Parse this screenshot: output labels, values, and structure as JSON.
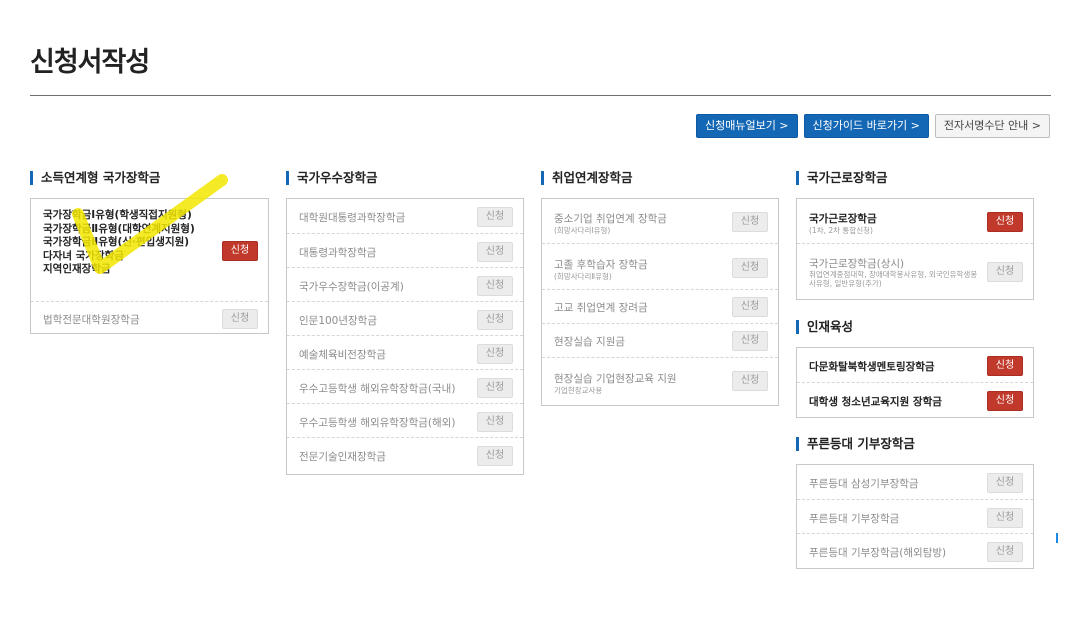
{
  "page": {
    "title": "신청서작성"
  },
  "top_buttons": [
    {
      "label": "신청매뉴얼보기 >"
    },
    {
      "label": "신청가이드 바로가기 >"
    },
    {
      "label": "전자서명수단 안내 >"
    }
  ],
  "apply_label": "신청",
  "col1": {
    "title": "소득연계형 국가장학금",
    "multi": [
      "국가장학금Ⅰ유형(학생직접지원형)",
      "국가장학금Ⅱ유형(대학연계지원형)",
      "국가장학금Ⅱ유형(신·편입생지원)",
      "다자녀 국가장학금",
      "지역인재장학금"
    ],
    "rows": [
      {
        "label": "법학전문대학원장학금"
      }
    ]
  },
  "col2": {
    "title": "국가우수장학금",
    "rows": [
      {
        "label": "대학원대통령과학장학금"
      },
      {
        "label": "대통령과학장학금"
      },
      {
        "label": "국가우수장학금(이공계)"
      },
      {
        "label": "인문100년장학금"
      },
      {
        "label": "예술체육비전장학금"
      },
      {
        "label": "우수고등학생 해외유학장학금(국내)"
      },
      {
        "label": "우수고등학생 해외유학장학금(해외)"
      },
      {
        "label": "전문기술인재장학금"
      }
    ]
  },
  "col3": {
    "title": "취업연계장학금",
    "rows": [
      {
        "label": "중소기업 취업연계 장학금",
        "sub": "(희망사다리Ⅰ유형)"
      },
      {
        "label": "고졸 후학습자 장학금",
        "sub": "(희망사다리Ⅱ유형)"
      },
      {
        "label": "고교 취업연계 장려금"
      },
      {
        "label": "현장실습 지원금"
      },
      {
        "label": "현장실습 기업현장교육 지원",
        "sub": "기업현장교사용"
      }
    ]
  },
  "col4": {
    "title": "국가근로장학금",
    "rows": [
      {
        "label": "국가근로장학금",
        "sub": "(1차, 2차 통합신청)"
      },
      {
        "label": "국가근로장학금(상시)",
        "sub": "취업연계중점대학, 장애대학봉사유형, 외국인유학생봉사유형, 일반유형(추가)"
      }
    ]
  },
  "col4b": {
    "title": "인재육성",
    "rows": [
      {
        "label": "다문화탈북학생멘토링장학금"
      },
      {
        "label": "대학생 청소년교육지원 장학금"
      }
    ]
  },
  "col4c": {
    "title": "푸른등대 기부장학금",
    "rows": [
      {
        "label": "푸른등대 삼성기부장학금"
      },
      {
        "label": "푸른등대 기부장학금"
      },
      {
        "label": "푸른등대 기부장학금(해외탐방)"
      }
    ]
  },
  "colors": {
    "accent": "#1467b5",
    "apply_active": "#c0392b",
    "highlight": "#f2e600"
  }
}
